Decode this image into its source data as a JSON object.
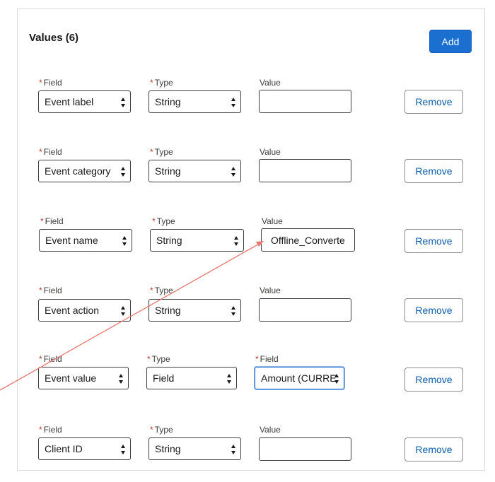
{
  "header": {
    "title": "Values (6)",
    "add_label": "Add"
  },
  "colors": {
    "accent": "#1b6fd1",
    "required": "#c23934",
    "annotation_arrow": "#e8786c"
  },
  "rows": [
    {
      "field_label": "Field",
      "field": "Event label",
      "type_label": "Type",
      "type": "String",
      "value_label": "Value",
      "value": "",
      "remove_label": "Remove"
    },
    {
      "field_label": "Field",
      "field": "Event category",
      "type_label": "Type",
      "type": "String",
      "value_label": "Value",
      "value": "",
      "remove_label": "Remove"
    },
    {
      "field_label": "Field",
      "field": "Event name",
      "type_label": "Type",
      "type": "String",
      "value_label": "Value",
      "value": "Offline_Converte",
      "remove_label": "Remove"
    },
    {
      "field_label": "Field",
      "field": "Event action",
      "type_label": "Type",
      "type": "String",
      "value_label": "Value",
      "value": "",
      "remove_label": "Remove"
    },
    {
      "field_label": "Field",
      "field": "Event value",
      "type_label": "Type",
      "type": "Field",
      "value_label": "Field",
      "value": "Amount (CURRE",
      "remove_label": "Remove"
    },
    {
      "field_label": "Field",
      "field": "Client ID",
      "type_label": "Type",
      "type": "String",
      "value_label": "Value",
      "value": "",
      "remove_label": "Remove"
    }
  ]
}
